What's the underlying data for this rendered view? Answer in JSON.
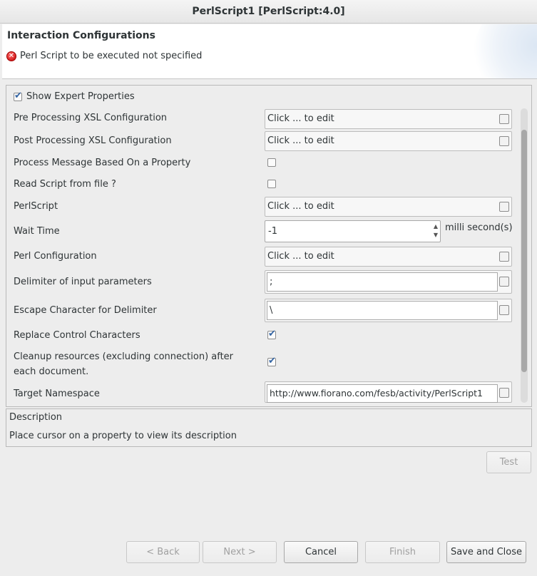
{
  "window": {
    "title": "PerlScript1 [PerlScript:4.0]"
  },
  "header": {
    "title": "Interaction Configurations",
    "error_message": "Perl Script to be executed not specified"
  },
  "properties": {
    "show_expert_label": "Show Expert Properties",
    "show_expert_checked": true,
    "rows": [
      {
        "label": "Pre Processing XSL Configuration",
        "value": "Click ... to edit"
      },
      {
        "label": "Post Processing XSL Configuration",
        "value": "Click ... to edit"
      },
      {
        "label": "Process Message Based On a Property",
        "checked": false
      },
      {
        "label": "Read Script from file ?",
        "checked": false
      },
      {
        "label": "PerlScript",
        "value": "Click ... to edit"
      },
      {
        "label": "Wait Time",
        "value": "-1",
        "unit": "milli second(s)"
      },
      {
        "label": "Perl Configuration",
        "value": "Click ... to edit"
      },
      {
        "label": "Delimiter of input parameters",
        "value": ";"
      },
      {
        "label": "Escape Character for Delimiter",
        "value": "\\"
      },
      {
        "label": "Replace Control Characters",
        "checked": true
      },
      {
        "label": "Cleanup resources (excluding connection) after each document.",
        "checked": true
      },
      {
        "label": "Target Namespace",
        "value": "http://www.fiorano.com/fesb/activity/PerlScript1"
      }
    ]
  },
  "description": {
    "title": "Description",
    "text": "Place cursor on a property to view its description"
  },
  "buttons": {
    "test": "Test",
    "back": "< Back",
    "next": "Next >",
    "cancel": "Cancel",
    "finish": "Finish",
    "save_close": "Save and Close"
  }
}
